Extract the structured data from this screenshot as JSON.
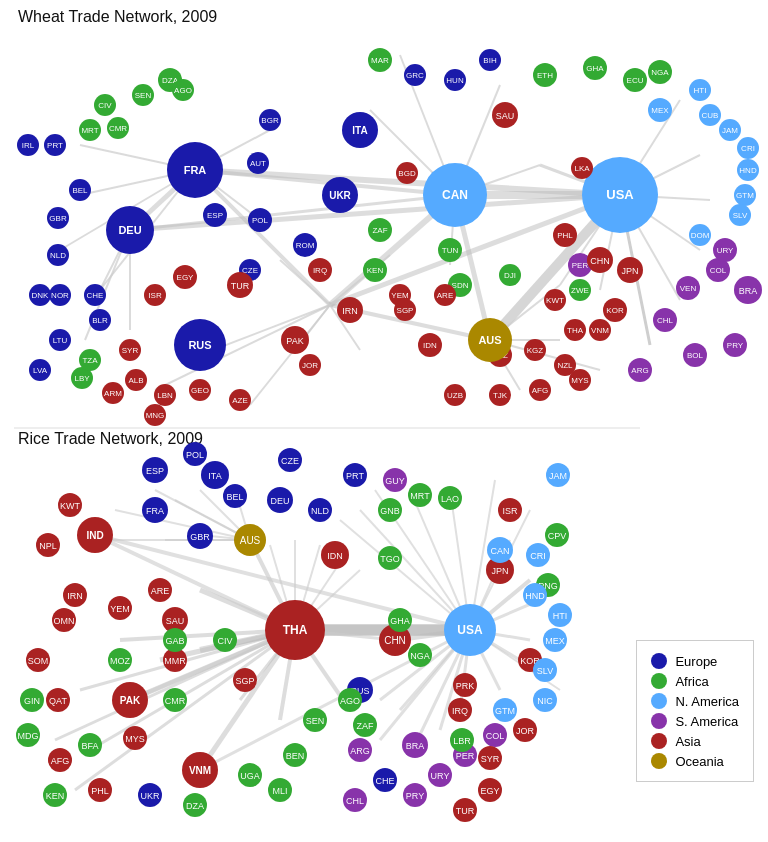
{
  "titles": {
    "wheat": "Wheat Trade Network, 2009",
    "rice": "Rice Trade Network, 2009"
  },
  "colors": {
    "europe": "#1a1aaa",
    "africa": "#33aa33",
    "n_america": "#55aaff",
    "s_america": "#8833aa",
    "asia": "#aa2222",
    "oceania": "#aa8800"
  },
  "legend": {
    "items": [
      {
        "label": "Europe",
        "color": "#1a1aaa"
      },
      {
        "label": "Africa",
        "color": "#33aa33"
      },
      {
        "label": "N. America",
        "color": "#55aaff"
      },
      {
        "label": "S. America",
        "color": "#8833aa"
      },
      {
        "label": "Asia",
        "color": "#aa2222"
      },
      {
        "label": "Oceania",
        "color": "#aa8800"
      }
    ]
  }
}
